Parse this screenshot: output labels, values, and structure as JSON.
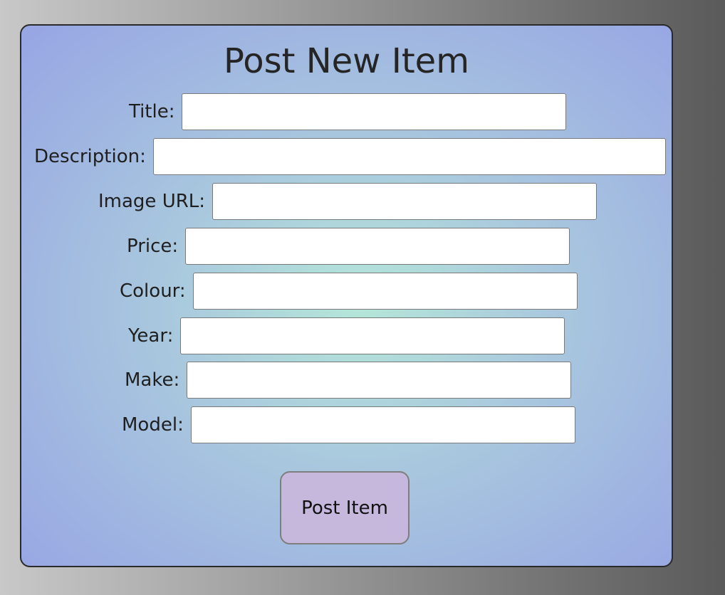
{
  "form": {
    "title": "Post New Item",
    "fields": [
      {
        "label": "Title:",
        "value": "",
        "placeholder": ""
      },
      {
        "label": "Description:",
        "value": "",
        "placeholder": ""
      },
      {
        "label": "Image URL:",
        "value": "",
        "placeholder": ""
      },
      {
        "label": "Price:",
        "value": "",
        "placeholder": ""
      },
      {
        "label": "Colour:",
        "value": "",
        "placeholder": ""
      },
      {
        "label": "Year:",
        "value": "",
        "placeholder": ""
      },
      {
        "label": "Make:",
        "value": "",
        "placeholder": ""
      },
      {
        "label": "Model:",
        "value": "",
        "placeholder": ""
      }
    ],
    "submit_label": "Post Item"
  },
  "colors": {
    "background_left": "#c8c8c8",
    "background_right": "#5a5a5a",
    "card_center": "#b4e6d8",
    "card_edge": "#97a5e4",
    "button": "#c6b8dc"
  }
}
